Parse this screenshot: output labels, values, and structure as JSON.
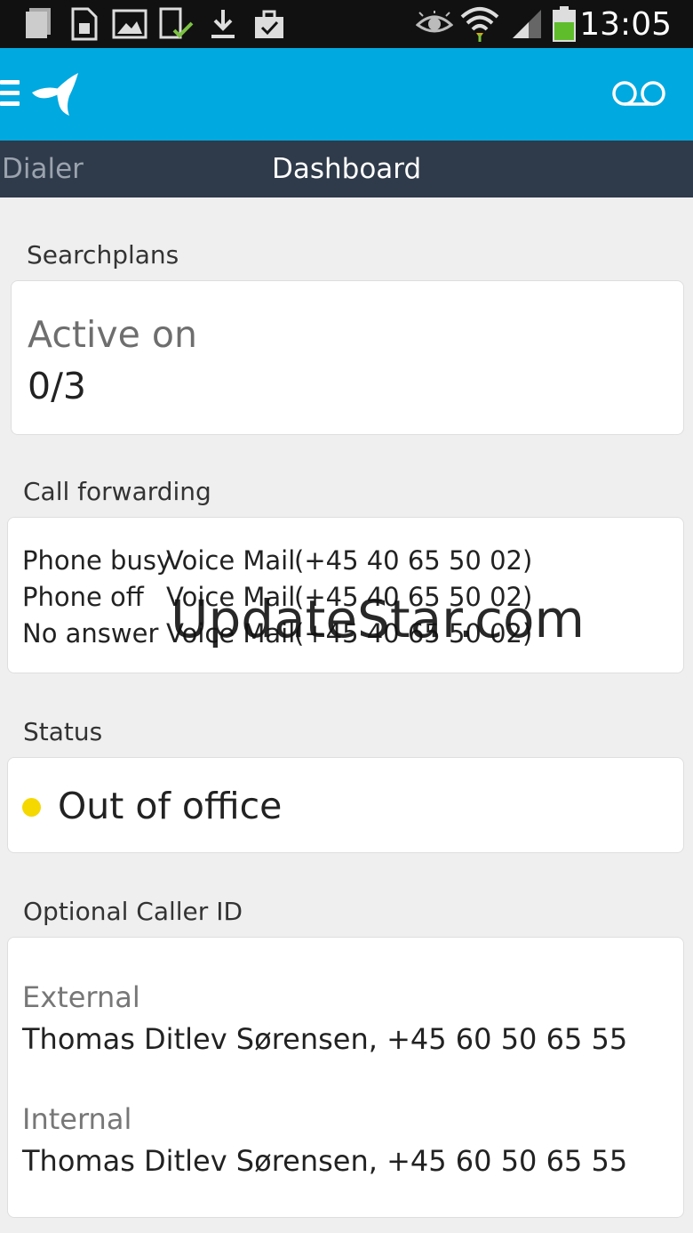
{
  "status_bar": {
    "time": "13:05",
    "icons": [
      "card-icon",
      "sim-icon",
      "gallery-icon",
      "tablet-check-icon",
      "download-icon",
      "bag-check-icon",
      "eye-icon",
      "wifi-icon",
      "signal-icon",
      "battery-icon"
    ],
    "battery_color": "#5fbd2b"
  },
  "app_bar": {
    "background": "#00a9e0",
    "menu_icon": "hamburger-icon",
    "logo_icon": "telenor-logo-icon",
    "action_icon": "voicemail-icon"
  },
  "tabs": [
    {
      "label": "Dialer"
    },
    {
      "label": "Dashboard"
    }
  ],
  "searchplans": {
    "title": "Searchplans",
    "label": "Active on",
    "value": "0/3"
  },
  "call_forwarding": {
    "title": "Call forwarding",
    "rows": [
      {
        "label": "Phone busy",
        "target": "Voice Mail",
        "number": "(+45 40 65 50 02)"
      },
      {
        "label": "Phone off",
        "target": "Voice Mail",
        "number": "(+45 40 65 50 02)"
      },
      {
        "label": "No answer",
        "target": "Voice Mail",
        "number": "(+45 40 65 50 02)"
      }
    ]
  },
  "status": {
    "title": "Status",
    "value": "Out of office",
    "dot_color": "#f5d800"
  },
  "caller_id": {
    "title": "Optional Caller ID",
    "external_label": "External",
    "external_value": "Thomas Ditlev Sørensen, +45 60 50 65 55",
    "internal_label": "Internal",
    "internal_value": "Thomas Ditlev Sørensen, +45 60 50 65 55"
  },
  "watermark": "UpdateStar.com"
}
